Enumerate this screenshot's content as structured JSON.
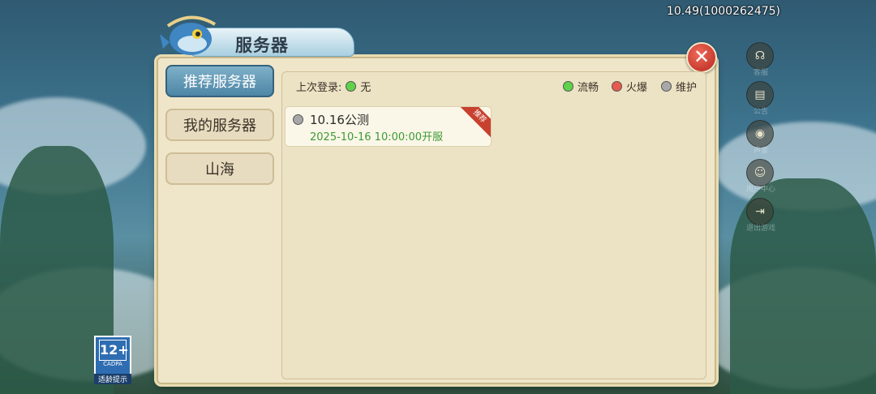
{
  "version": "10.49(1000262475)",
  "dialog": {
    "title": "服务器",
    "close_label": "✕"
  },
  "tabs": [
    {
      "label": "推荐服务器",
      "active": true
    },
    {
      "label": "我的服务器",
      "active": false
    },
    {
      "label": "山海",
      "active": false
    }
  ],
  "last_login": {
    "label": "上次登录:",
    "status_color": "#5fd24a",
    "value": "无"
  },
  "legend": [
    {
      "label": "流畅",
      "color": "#5fd24a"
    },
    {
      "label": "火爆",
      "color": "#e85a4f"
    },
    {
      "label": "维护",
      "color": "#a8a8a8"
    }
  ],
  "servers": [
    {
      "name": "10.16公测",
      "open_time": "2025-10-16 10:00:00开服",
      "status_color": "#a8a8a8",
      "ribbon": "推荐"
    }
  ],
  "age_rating": {
    "number": "12+",
    "org": "CADPA",
    "tip": "适龄提示"
  },
  "side_icons": [
    {
      "icon": "headset-icon",
      "label": "客服"
    },
    {
      "icon": "notice-icon",
      "label": "公告"
    },
    {
      "icon": "sound-icon",
      "label": "声音"
    },
    {
      "icon": "user-center-icon",
      "label": "用户中心"
    },
    {
      "icon": "exit-icon",
      "label": "退出游戏"
    }
  ]
}
